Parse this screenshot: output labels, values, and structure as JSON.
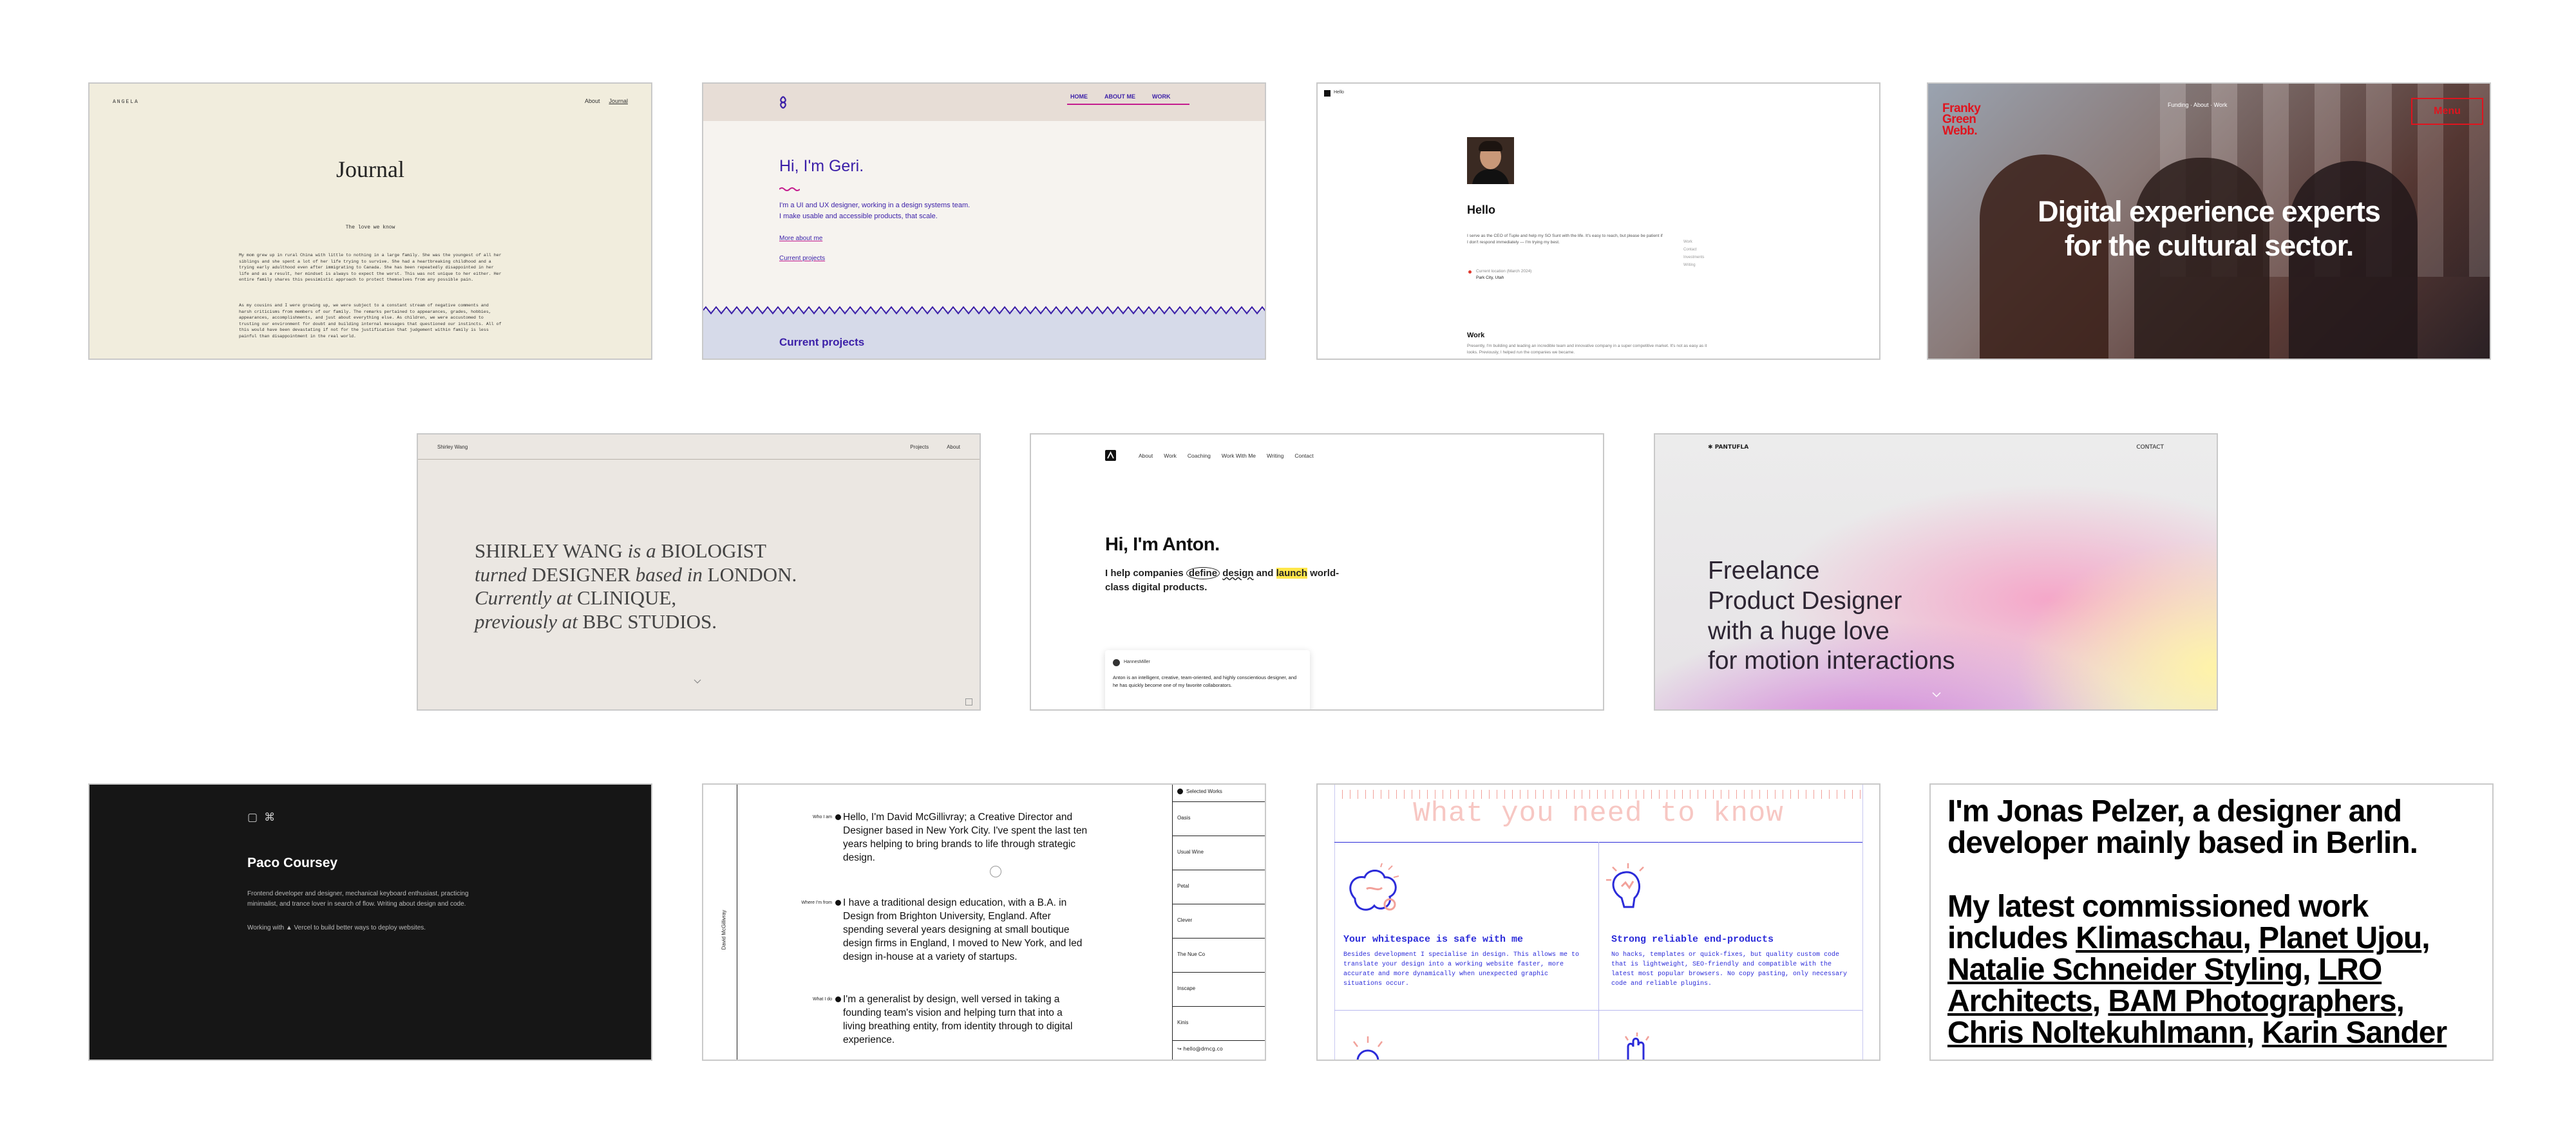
{
  "tiles": {
    "journal": {
      "brand": "ANGELA",
      "nav": [
        "About",
        "Journal"
      ],
      "title": "Journal",
      "post_title": "The love we know",
      "para1": "My mom grew up in rural China with little to nothing in a large family. She was the youngest of all her siblings and she spent a lot of her life trying to survive. She had a heartbreaking childhood and a trying early adulthood even after immigrating to Canada. She has been repeatedly disappointed in her life and as a result, her mindset is always to expect the worst. This was not unique to her either. Her entire family shares this pessimistic approach to protect themselves from any possible pain.",
      "para2": "As my cousins and I were growing up, we were subject to a constant stream of negative comments and harsh criticisms from members of our family. The remarks pertained to appearances, grades, hobbies, appearances, accomplishments, and just about everything else. As children, we were accustomed to trusting our environment for doubt and building internal messages that questioned our instincts. All of this would have been devastating if not for the justification that judgement within family is less painful than disappointment in the real world."
    },
    "geri": {
      "nav": [
        "HOME",
        "ABOUT ME",
        "WORK"
      ],
      "heading": "Hi, I'm Geri.",
      "intro_line1": "I'm a UI and UX designer, working in a design systems team.",
      "intro_line2": "I make usable and accessible products, that scale.",
      "link1": "More about me",
      "link2": "Current projects",
      "section": "Current projects"
    },
    "hello": {
      "brand": "Hello",
      "heading": "Hello",
      "bio": "I serve as the CEO of Tuple and help my SO Sunt with the life. It's easy to reach, but please be patient if I don't respond immediately — I'm trying my best.",
      "location_label": "Current location (March 2024)",
      "location_value": "Park City, Utah",
      "side_links": [
        "Work",
        "Contact",
        "Investments",
        "Writing"
      ],
      "work_heading": "Work",
      "work_text": "Presently, I'm building and leading an incredible team and innovative company in a super competitive market. It's not as easy as it looks. Previously, I helped run the companies we became."
    },
    "franky": {
      "logo": "Franky Green Webb.",
      "nav_center": "Funding · About · Work",
      "menu": "Menu",
      "headline": "Digital experience experts for the cultural sector."
    },
    "shirley": {
      "brand": "Shirley Wang",
      "nav": [
        "Projects",
        "About"
      ],
      "line1_a": "SHIRLEY WANG ",
      "line1_b": "is a",
      "line1_c": " BIOLOGIST",
      "line2_a": "turned",
      "line2_b": " DESIGNER ",
      "line2_c": "based in",
      "line2_d": " LONDON.",
      "line3_a": "Currently at",
      "line3_b": " CLINIQUE,",
      "line4_a": "previously at",
      "line4_b": " BBC STUDIOS."
    },
    "anton": {
      "nav": [
        "About",
        "Work",
        "Coaching",
        "Work With Me",
        "Writing",
        "Contact"
      ],
      "heading": "Hi, I'm Anton.",
      "sub_a": "I help companies ",
      "sub_define": "define",
      "sub_design": "design",
      "sub_and": " and ",
      "sub_launch": "launch",
      "sub_b": " world-",
      "sub_c": "class digital products.",
      "card_name": "HannesMiller",
      "card_text": "Anton is an intelligent, creative, team-oriented, and highly conscientious designer, and he has quickly become one of my favorite collaborators."
    },
    "pantufla": {
      "brand": "PANTUFLA",
      "nav": "CONTACT",
      "headline": [
        "Freelance",
        "Product Designer",
        "with a huge love",
        "for motion interactions"
      ]
    },
    "paco": {
      "name": "Paco Coursey",
      "bio": "Frontend developer and designer, mechanical keyboard enthusiast, practicing minimalist, and trance lover in search of flow. Writing about design and code.",
      "working": "Working with ▲ Vercel to build better ways to deploy websites."
    },
    "david": {
      "side_name": "David McGillivray",
      "sections": [
        {
          "label": "Who I am",
          "text": "Hello, I'm David McGillivray; a Creative Director and Designer based in New York City. I've spent the last ten years helping to bring brands to life through strategic design."
        },
        {
          "label": "Where I'm from",
          "text": "I have a traditional design education, with a B.A. in Design from Brighton University, England. After spending several years designing at small boutique design firms in England, I moved to New York, and led design in-house at a variety of startups."
        },
        {
          "label": "What I do",
          "text": "I'm a generalist by design, well versed in taking a founding team's vision and helping turn that into a living breathing entity, from identity through to digital experience."
        }
      ],
      "works_title": "Selected Works",
      "works": [
        "Oasis",
        "Usual Wine",
        "Petal",
        "Clever",
        "The Nue Co",
        "Inscape",
        "Kinis"
      ],
      "email": "hello@dmcg.co"
    },
    "whatyouneed": {
      "title": "What you need to know",
      "card1_title": "Your whitespace is safe with me",
      "card1_text": "Besides development I specialise in design. This allows me to translate your design into a working website faster, more accurate and more dynamically when unexpected graphic situations occur.",
      "card2_title": "Strong reliable end-products",
      "card2_text": "No hacks, templates or quick-fixes, but quality custom code that is lightweight, SEO-friendly and compatible with the latest most popular browsers. No copy pasting, only necessary code and reliable plugins."
    },
    "jonas": {
      "line1": "I'm Jonas Pelzer, a designer and developer mainly based in Berlin.",
      "line2_prefix": "My latest commissioned work includes ",
      "links": [
        "Klimaschau",
        "Planet Ujou",
        "Natalie Schneider Styling",
        "LRO Architects",
        "BAM Photographers",
        "Chris Noltekuhlmann",
        "Karin Sander"
      ]
    }
  },
  "colors": {
    "geri_purple": "#3b1fa8",
    "geri_pink": "#c41c8e",
    "franky_red": "#e0141e",
    "whatyouneed_blue": "#2b2bd9",
    "whatyouneed_salmon": "#f2a19a",
    "anton_highlight": "#ffe74a"
  }
}
